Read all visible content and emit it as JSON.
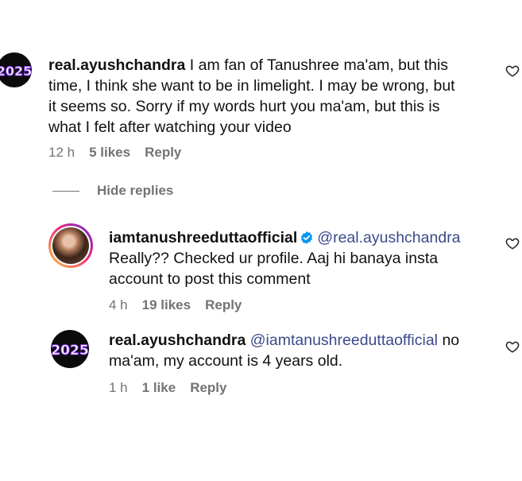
{
  "comments": [
    {
      "username": "real.ayushchandra",
      "mention": "",
      "lines": [
        "I am fan of Tanushree ma'am, but this",
        "time, I think she want to be in limelight. I may be wrong, but",
        "it seems so. Sorry if my words hurt you ma'am, but this is",
        "what I felt after watching your video"
      ],
      "time": "12 h",
      "likes": "5 likes",
      "reply": "Reply",
      "avatar_text": "2025"
    },
    {
      "username": "iamtanushreeduttaofficial",
      "mention": "@real.ayushchandra",
      "lines": [
        "Really?? Checked ur profile. Aaj hi banaya insta",
        "account to post this comment"
      ],
      "time": "4 h",
      "likes": "19 likes",
      "reply": "Reply",
      "verified": true
    },
    {
      "username": "real.ayushchandra",
      "mention": "@iamtanushreeduttaofficial",
      "after_mention": "no",
      "lines": [
        "ma'am, my account is 4 years old."
      ],
      "time": "1 h",
      "likes": "1 like",
      "reply": "Reply",
      "avatar_text": "2025"
    }
  ],
  "hide_replies": "Hide replies",
  "icons": {
    "heart": "heart-outline-icon",
    "verified": "verified-badge-icon"
  },
  "colors": {
    "meta_gray": "#737373",
    "mention_blue": "#3b4a8a",
    "verified_blue": "#0095f6"
  }
}
